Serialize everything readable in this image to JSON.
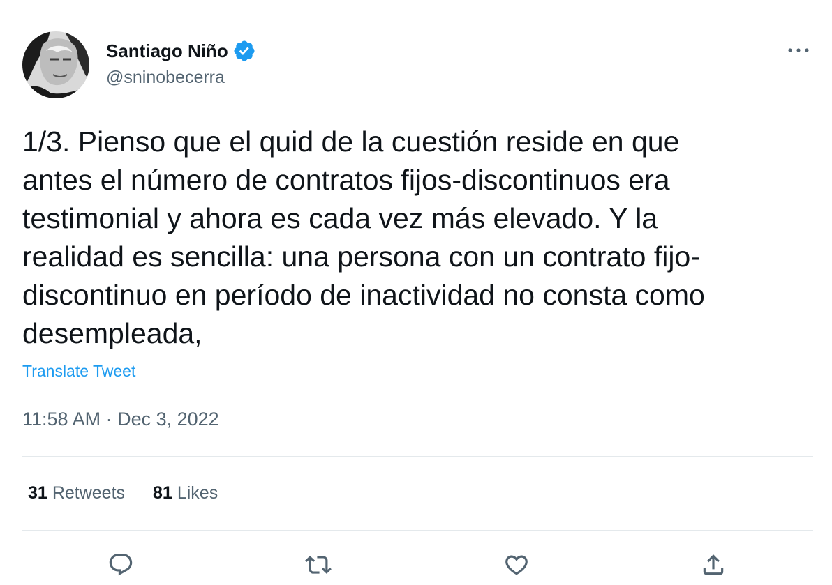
{
  "author": {
    "name": "Santiago Niño",
    "handle": "@sninobecerra",
    "verified": true,
    "avatar_icon": "avatar-photo"
  },
  "tweet": {
    "text": "1/3. Pienso que el quid de la cuestión reside en que\nantes el número de contratos fijos-discontinuos era\ntestimonial y ahora es cada vez más elevado. Y la\nrealidad es sencilla: una persona con un contrato fijo-\ndiscontinuo en período de inactividad no consta como\ndesempleada,",
    "translate_label": "Translate Tweet",
    "timestamp": "11:58 AM · Dec 3, 2022"
  },
  "stats": {
    "retweets_count": "31",
    "retweets_label": "Retweets",
    "likes_count": "81",
    "likes_label": "Likes"
  },
  "actions": [
    "reply-icon",
    "retweet-icon",
    "like-icon",
    "share-icon"
  ],
  "colors": {
    "text": "#0f1419",
    "secondary": "#536471",
    "accent": "#1d9bf0",
    "divider": "#e4e9ec"
  }
}
